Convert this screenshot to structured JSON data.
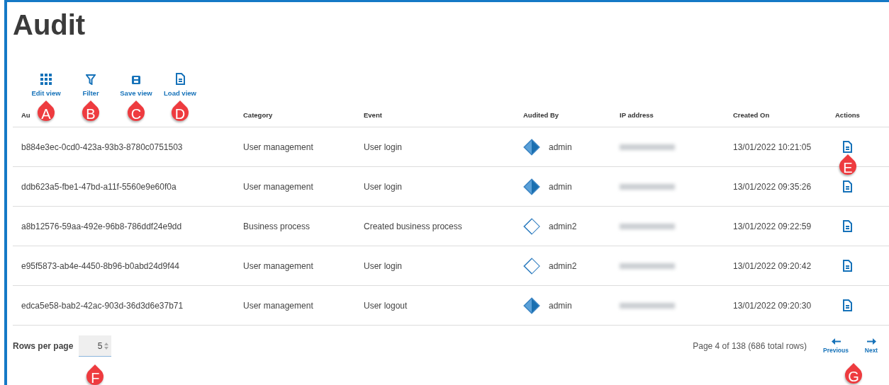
{
  "title": "Audit",
  "toolbar": [
    {
      "kind": "grid",
      "label": "Edit view",
      "marker": "A"
    },
    {
      "kind": "filter",
      "label": "Filter",
      "marker": "B"
    },
    {
      "kind": "save",
      "label": "Save view",
      "marker": "C"
    },
    {
      "kind": "doc",
      "label": "Load view",
      "marker": "D"
    }
  ],
  "table": {
    "columns": [
      "Au",
      "Category",
      "Event",
      "Audited By",
      "IP address",
      "Created On",
      "Actions"
    ],
    "rows": [
      {
        "id": "b884e3ec-0cd0-423a-93b3-8780c0751503",
        "category": "User management",
        "event": "User login",
        "user": "admin",
        "kind": "filled",
        "created": "13/01/2022 10:21:05",
        "marker": "E"
      },
      {
        "id": "ddb623a5-fbe1-47bd-a11f-5560e9e60f0a",
        "category": "User management",
        "event": "User login",
        "user": "admin",
        "kind": "filled",
        "created": "13/01/2022 09:35:26"
      },
      {
        "id": "a8b12576-59aa-492e-96b8-786ddf24e9dd",
        "category": "Business process",
        "event": "Created business process",
        "user": "admin2",
        "kind": "outline",
        "created": "13/01/2022 09:22:59"
      },
      {
        "id": "e95f5873-ab4e-4450-8b96-b0abd24d9f44",
        "category": "User management",
        "event": "User login",
        "user": "admin2",
        "kind": "outline",
        "created": "13/01/2022 09:20:42"
      },
      {
        "id": "edca5e58-bab2-42ac-903d-36d3d6e37b71",
        "category": "User management",
        "event": "User logout",
        "user": "admin",
        "kind": "filled",
        "created": "13/01/2022 09:20:30"
      }
    ]
  },
  "footer": {
    "rows_label": "Rows per page",
    "rows_value": "5",
    "rows_marker": "F",
    "page_info": "Page 4 of 138 (686 total rows)",
    "previous": "Previous",
    "next": "Next",
    "nav_marker": "G"
  }
}
